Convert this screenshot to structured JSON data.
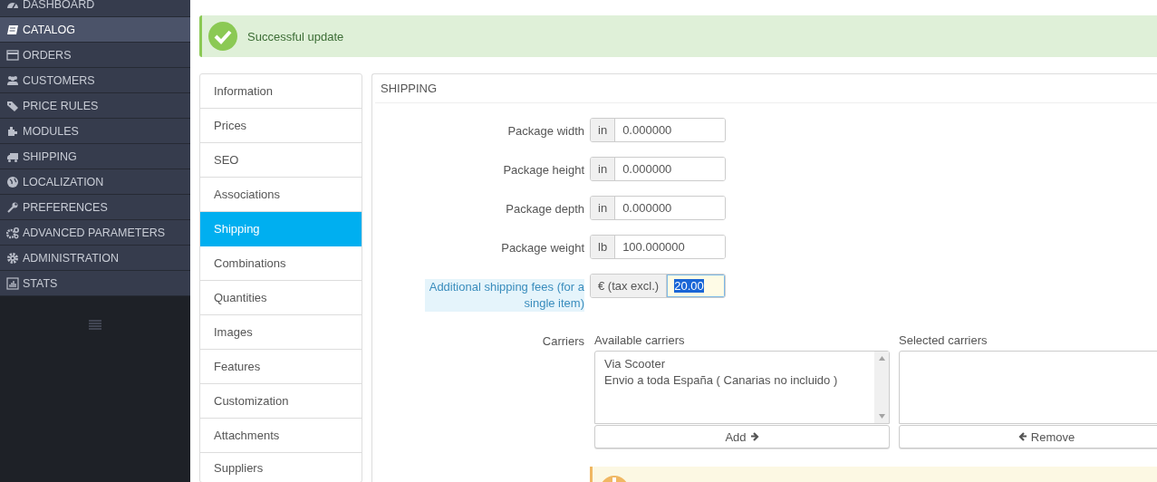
{
  "sidebar": {
    "items": [
      {
        "label": "DASHBOARD",
        "selected": false
      },
      {
        "label": "CATALOG",
        "selected": true
      },
      {
        "label": "ORDERS",
        "selected": false
      },
      {
        "label": "CUSTOMERS",
        "selected": false
      },
      {
        "label": "PRICE RULES",
        "selected": false
      },
      {
        "label": "MODULES",
        "selected": false
      },
      {
        "label": "SHIPPING",
        "selected": false
      },
      {
        "label": "LOCALIZATION",
        "selected": false
      },
      {
        "label": "PREFERENCES",
        "selected": false
      },
      {
        "label": "ADVANCED PARAMETERS",
        "selected": false
      },
      {
        "label": "ADMINISTRATION",
        "selected": false
      },
      {
        "label": "STATS",
        "selected": false
      }
    ]
  },
  "alert": {
    "message": "Successful update"
  },
  "tabs": [
    {
      "label": "Information",
      "selected": false
    },
    {
      "label": "Prices",
      "selected": false
    },
    {
      "label": "SEO",
      "selected": false
    },
    {
      "label": "Associations",
      "selected": false
    },
    {
      "label": "Shipping",
      "selected": true
    },
    {
      "label": "Combinations",
      "selected": false
    },
    {
      "label": "Quantities",
      "selected": false
    },
    {
      "label": "Images",
      "selected": false
    },
    {
      "label": "Features",
      "selected": false
    },
    {
      "label": "Customization",
      "selected": false
    },
    {
      "label": "Attachments",
      "selected": false
    },
    {
      "label": "Suppliers",
      "selected": false
    }
  ],
  "panel": {
    "title": "SHIPPING",
    "fields": [
      {
        "label": "Package width",
        "hint": false,
        "addon": "in",
        "value": "0.000000",
        "focused": false
      },
      {
        "label": "Package height",
        "hint": false,
        "addon": "in",
        "value": "0.000000",
        "focused": false
      },
      {
        "label": "Package depth",
        "hint": false,
        "addon": "in",
        "value": "0.000000",
        "focused": false
      },
      {
        "label": "Package weight",
        "hint": false,
        "addon": "lb",
        "value": "100.000000",
        "focused": false
      },
      {
        "label": "Additional shipping fees (for a single item)",
        "hint": true,
        "addon": "€ (tax excl.)",
        "value": "20.00",
        "focused": true
      }
    ],
    "carriers": {
      "label": "Carriers",
      "available": {
        "title": "Available carriers",
        "options": [
          "Via Scooter",
          "Envio a toda España ( Canarias no incluido )"
        ],
        "button": "Add"
      },
      "selected": {
        "title": "Selected carriers",
        "button": "Remove"
      }
    }
  }
}
